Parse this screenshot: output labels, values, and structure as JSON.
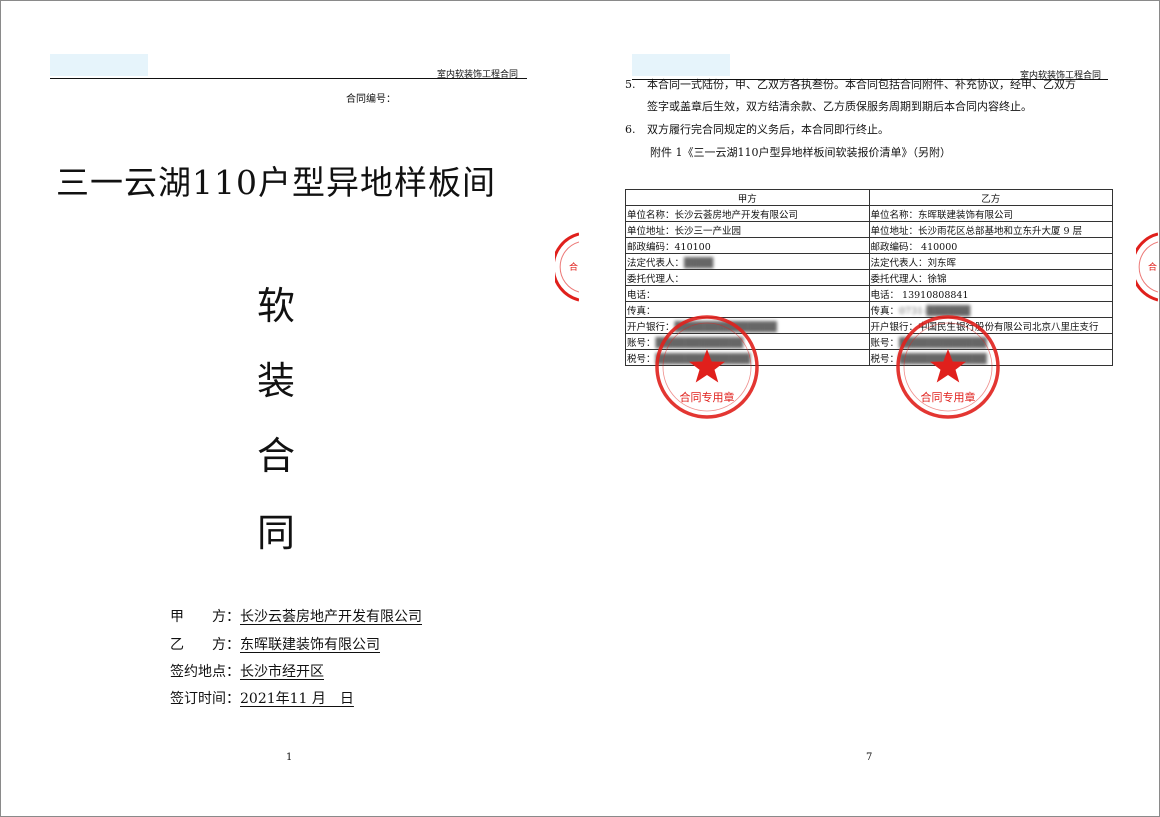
{
  "page1": {
    "header": "室内软装饰工程合同",
    "contract_no_label": "合同编号：",
    "title": "三一云湖110户型异地样板间",
    "vertical_title": [
      "软",
      "装",
      "合",
      "同"
    ],
    "parties": [
      {
        "label": "甲　　方：",
        "value": "长沙云荟房地产开发有限公司"
      },
      {
        "label": "乙　　方：",
        "value": "东晖联建装饰有限公司"
      },
      {
        "label": "签约地点：",
        "value": "长沙市经开区"
      },
      {
        "label": "签订时间：",
        "value": "2021年11 月　日"
      }
    ],
    "page_number": "1"
  },
  "page2": {
    "header": "室内软装饰工程合同",
    "clauses": [
      {
        "num": "5.",
        "line1": "本合同一式陆份，甲、乙双方各执叁份。本合同包括合同附件、补充协议，经甲、乙双方",
        "line2": "签字或盖章后生效，双方结清余款、乙方质保服务周期到期后本合同内容终止。"
      },
      {
        "num": "6.",
        "line1": "双方履行完合同规定的义务后，本合同即行终止。",
        "line2": ""
      }
    ],
    "attachment": "附件 1《三一云湖110户型异地样板间软装报价清单》（另附）",
    "table": {
      "headers": [
        "甲方",
        "乙方"
      ],
      "rows": [
        [
          "单位名称：长沙云荟房地产开发有限公司",
          "单位名称：东晖联建装饰有限公司"
        ],
        [
          "单位地址：长沙三一产业园",
          "单位地址：长沙雨花区总部基地和立东升大厦 9 层"
        ],
        [
          "邮政编码：410100",
          "邮政编码： 410000"
        ],
        [
          "法定代表人：",
          "法定代表人：刘东晖"
        ],
        [
          "委托代理人：",
          "委托代理人：徐锦"
        ],
        [
          "电话：",
          "电话： 13910808841"
        ],
        [
          "传真：",
          "传真："
        ],
        [
          "开户银行：",
          "开户银行：中国民生银行股份有限公司北京八里庄支行"
        ],
        [
          "账号：",
          "账号："
        ],
        [
          "税号：",
          "税号："
        ]
      ]
    },
    "seal_text": [
      "合同专用章",
      "合同专用章"
    ],
    "page_number": "7"
  },
  "colors": {
    "seal_red": "#e0201c",
    "header_tab": "#e6f4fb"
  }
}
